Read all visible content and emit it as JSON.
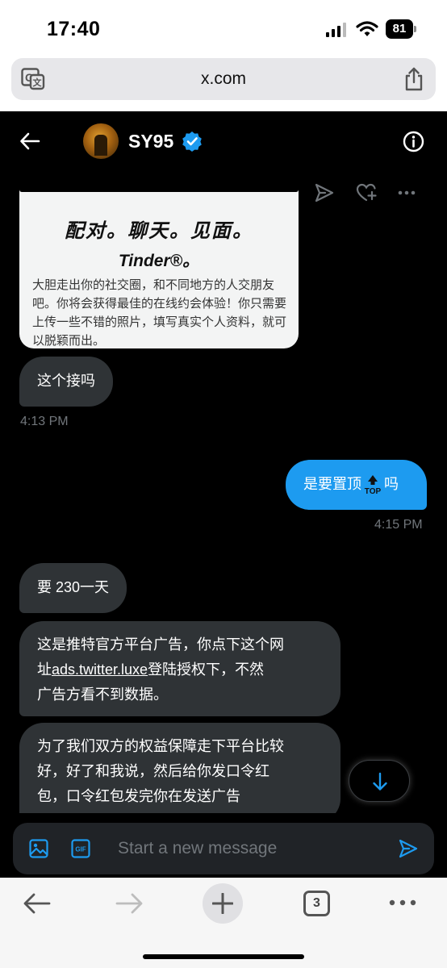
{
  "status_bar": {
    "time": "17:40",
    "battery": "81"
  },
  "browser": {
    "url": "x.com",
    "tab_count": "3"
  },
  "conversation": {
    "name": "SY95"
  },
  "card": {
    "headline": "配对。聊天。见面。",
    "brand": "Tinder®。",
    "body": "大胆走出你的社交圈，和不同地方的人交朋友吧。你将会获得最佳的在线约会体验！你只需要上传一些不错的照片，填写真实个人资料，就可以脱颖而出。"
  },
  "messages": [
    {
      "text": "这个接吗",
      "time": "4:13 PM",
      "from": "them"
    },
    {
      "text_before": "是要置顶",
      "badge": "TOP",
      "text_after": "吗",
      "time": "4:15 PM",
      "from": "me"
    },
    {
      "text": "要 230一天",
      "from": "them"
    },
    {
      "line1": "这是推特官方平台广告，你点下这个网",
      "line2_prefix": "址",
      "link": "ads.twitter.luxe",
      "line2_suffix": "登陆授权下，不然",
      "line3": "广告方看不到数据。",
      "from": "them"
    },
    {
      "line1": "为了我们双方的权益保障走下平台比较",
      "line2": "好，好了和我说，然后给你发口令红",
      "line3": "包，口令红包发完你在发送广告",
      "from": "them"
    }
  ],
  "composer": {
    "placeholder": "Start a new message"
  },
  "colors": {
    "accent": "#1d9bf0",
    "bubble_in": "#2f3336",
    "background": "#000000"
  }
}
